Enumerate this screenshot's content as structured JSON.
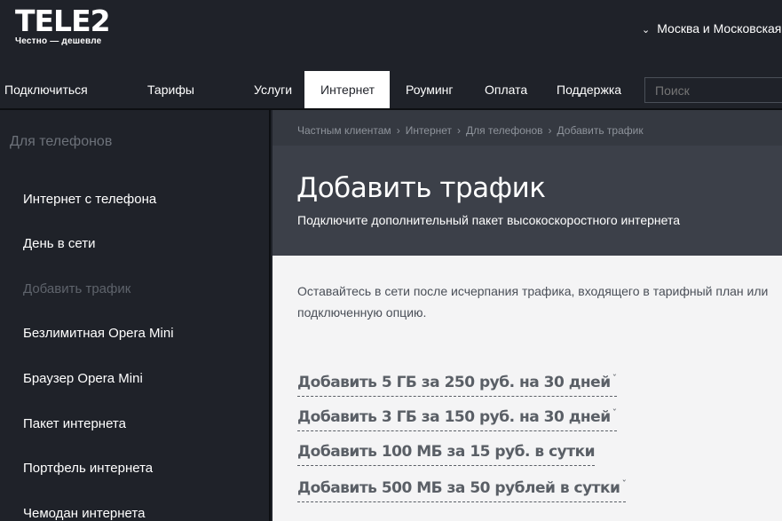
{
  "header": {
    "logo_main": "TELE2",
    "logo_tagline": "Честно — дешевле",
    "region": "Москва и Московская о",
    "region_chevron": "⌄"
  },
  "nav": {
    "items": [
      {
        "label": "Подключиться"
      },
      {
        "label": "Тарифы"
      },
      {
        "label": "Услуги"
      },
      {
        "label": "Интернет",
        "active": true
      },
      {
        "label": "Роуминг"
      },
      {
        "label": "Оплата"
      },
      {
        "label": "Поддержка"
      }
    ],
    "search_placeholder": "Поиск"
  },
  "sidebar": {
    "title": "Для телефонов",
    "items": [
      {
        "label": "Интернет с телефона"
      },
      {
        "label": "День в сети"
      },
      {
        "label": "Добавить трафик",
        "current": true
      },
      {
        "label": "Безлимитная Opera Mini"
      },
      {
        "label": "Браузер Opera Mini"
      },
      {
        "label": "Пакет интернета"
      },
      {
        "label": "Портфель интернета"
      },
      {
        "label": "Чемодан интернета"
      }
    ]
  },
  "breadcrumbs": [
    "Частным клиентам",
    "Интернет",
    "Для телефонов",
    "Добавить трафик"
  ],
  "breadcrumb_separator": "›",
  "page": {
    "title": "Добавить трафик",
    "subtitle": "Подключите дополнительный пакет высокоскоростного интернета",
    "intro_line1": "Оставайтесь в сети после исчерпания трафика, входящего в тарифный план или",
    "intro_line2": "подключенную опцию.",
    "option_chevron": "ˇ",
    "options": [
      {
        "label": "Добавить 5 ГБ за 250 руб. на 30 дней"
      },
      {
        "label": "Добавить 3 ГБ за 150 руб. на 30 дней"
      },
      {
        "label": "Добавить 100 МБ за 15 руб. в сутки"
      },
      {
        "label": "Добавить 500 МБ за 50 рублей в сутки"
      }
    ]
  },
  "colors": {
    "header_bg": "#1f2229",
    "hero_bg": "#3c4049",
    "content_bg": "#f4f4f5",
    "active_tab_bg": "#ffffff"
  }
}
